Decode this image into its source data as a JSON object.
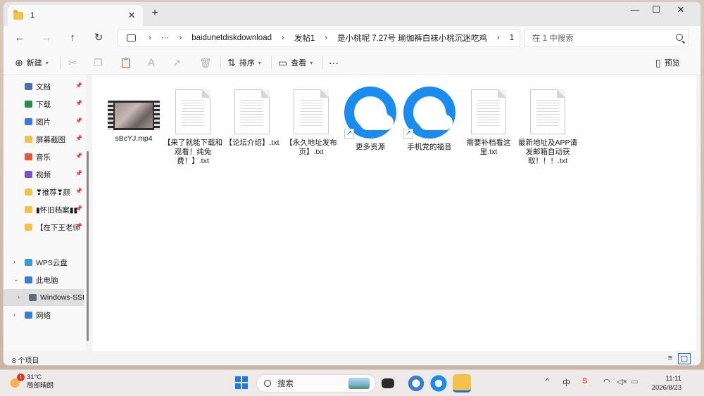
{
  "window": {
    "tab_title": "1",
    "tab_close": "✕",
    "new_tab": "+",
    "controls": {
      "minimize": "—",
      "maximize": "☐",
      "close": "✕"
    }
  },
  "address": {
    "more": "···",
    "crumbs": [
      "baidunetdiskdownload",
      "发帖1",
      "是小桃呢 7.27号 瑜伽裤白袜小桃沉迷吃鸡",
      "1"
    ],
    "separator": "›"
  },
  "search": {
    "placeholder": "在 1 中搜索"
  },
  "toolbar": {
    "new_label": "新建",
    "sort_label": "排序",
    "view_label": "查看",
    "more_label": "···",
    "preview_label": "预览"
  },
  "sidebar": {
    "quick_access": [
      {
        "label": "文档",
        "color": "#4a6fa5"
      },
      {
        "label": "下载",
        "color": "#2a8a4a"
      },
      {
        "label": "图片",
        "color": "#3a7bd5"
      },
      {
        "label": "屏幕截图",
        "color": "#f2c24d"
      },
      {
        "label": "音乐",
        "color": "#e4553a"
      },
      {
        "label": "视频",
        "color": "#7b4fc9"
      },
      {
        "label": "❣推荐❣颜",
        "color": "#f2c24d"
      },
      {
        "label": "▮怀旧档案▮▮",
        "color": "#f2c24d"
      },
      {
        "label": "【在下王老师",
        "color": "#f2c24d"
      }
    ],
    "tree": [
      {
        "label": "WPS云盘"
      },
      {
        "label": "此电脑"
      },
      {
        "label": "Windows-SSD"
      },
      {
        "label": "网络"
      }
    ]
  },
  "files": [
    {
      "name": "sBcYJ.mp4",
      "type": "video"
    },
    {
      "name": "【来了就能下载和观看！纯免费！】.txt",
      "type": "txt"
    },
    {
      "name": "【论坛介绍】.txt",
      "type": "txt"
    },
    {
      "name": "【永久地址发布页】.txt",
      "type": "txt"
    },
    {
      "name": "更多资源",
      "type": "shortcut"
    },
    {
      "name": "手机党的福音",
      "type": "shortcut"
    },
    {
      "name": "需要补档看这里.txt",
      "type": "txt"
    },
    {
      "name": "最新地址及APP请发邮箱自动获取！！！.txt",
      "type": "txt"
    }
  ],
  "status": {
    "item_count": "8 个项目"
  },
  "taskbar": {
    "weather_temp": "31°C",
    "weather_desc": "局部晴朗",
    "weather_badge": "1",
    "search_label": "搜索",
    "time": "11:11",
    "date": "2026/8/23",
    "tray_ime": "中",
    "tray_up": "^"
  },
  "colors": {
    "accent": "#1a8cf0",
    "folder": "#f2c24d"
  }
}
